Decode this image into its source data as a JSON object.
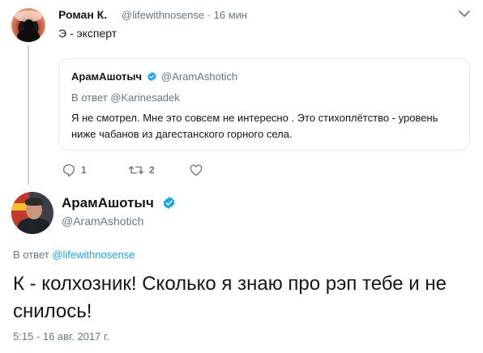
{
  "colors": {
    "text": "#14171a",
    "secondary": "#657786",
    "link": "#1da1f2",
    "verified": "#1da1f2",
    "border": "#e1e8ed",
    "thread_line": "#ccd6dd"
  },
  "parent_tweet": {
    "author_name": "Роман К.",
    "meta": "@lifewithnosense · 16 мин",
    "text": "Э - эксперт",
    "menu_icon": "chevron-down-icon",
    "quoted_tweet": {
      "author_name": "АрамАшотыч",
      "verified_icon": "verified-badge-icon",
      "handle": "@AramAshotich",
      "reply_to": "В ответ @Karinesadek",
      "text": "Я не смотрел. Мне это совсем не интересно . Это стихоплётство - уровень ниже чабанов из дагестанского горного села."
    },
    "actions": {
      "reply_icon": "reply-icon",
      "reply_count": "1",
      "retweet_icon": "retweet-icon",
      "retweet_count": "2",
      "like_icon": "heart-icon"
    }
  },
  "main_tweet": {
    "author_name": "АрамАшотыч",
    "verified_icon": "verified-badge-icon",
    "handle": "@AramAshotich",
    "reply_prefix": "В ответ",
    "reply_to": "@lifewithnosense",
    "text": "К - колхозник! Сколько я знаю про рэп тебе и не снилось!",
    "timestamp": "5:15 - 16 авг. 2017 г."
  }
}
